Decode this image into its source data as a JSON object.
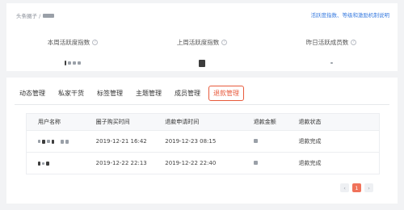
{
  "breadcrumb": {
    "prefix": "头条圈子 /"
  },
  "help_link": "活跃度指数、等级和激励机制说明",
  "stats": [
    {
      "label": "本周活跃度指数",
      "help_icon": "?"
    },
    {
      "label": "上周活跃度指数",
      "help_icon": "?"
    },
    {
      "label": "昨日活跃成员数",
      "help_icon": "?"
    }
  ],
  "tabs": [
    "动态管理",
    "私家干货",
    "标签管理",
    "主题管理",
    "成员管理",
    "退款管理"
  ],
  "active_tab": "退款管理",
  "table": {
    "columns": [
      "用户名称",
      "圈子购买时间",
      "退款申请时间",
      "退款金额",
      "退款状态"
    ],
    "rows": [
      {
        "purchase_time": "2019-12-21 16:42",
        "refund_time": "2019-12-23 08:15",
        "status": "退款完成"
      },
      {
        "purchase_time": "2019-12-22 22:13",
        "refund_time": "2019-12-22 22:40",
        "status": "退款完成"
      }
    ]
  },
  "pagination": {
    "prev": "‹",
    "current": "1",
    "next": "›"
  },
  "colors": {
    "accent": "#e85a3c",
    "link": "#3b7de0",
    "page_bg": "#f2f3f5"
  }
}
